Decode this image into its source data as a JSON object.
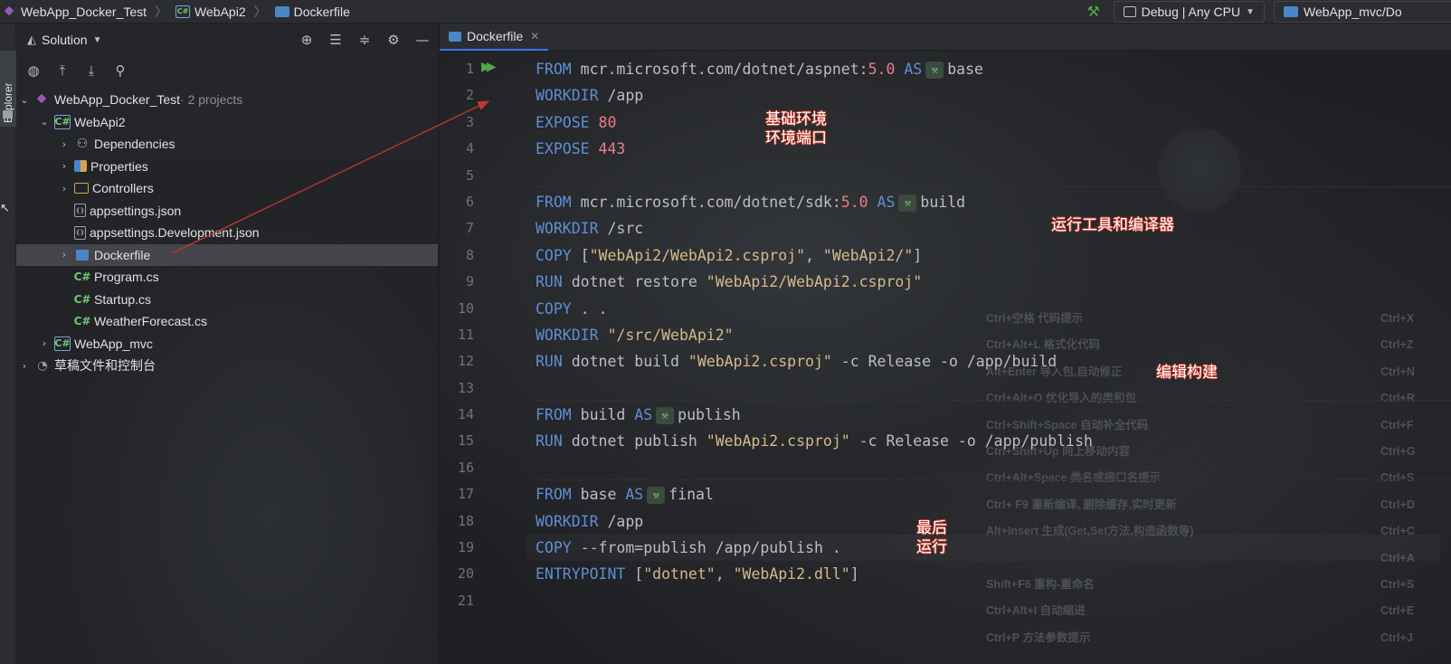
{
  "breadcrumb": {
    "solution": "WebApp_Docker_Test",
    "project": "WebApi2",
    "file": "Dockerfile"
  },
  "run_config": {
    "build_config": "Debug | Any CPU",
    "target": "WebApp_mvc/Do"
  },
  "sidebar_strip": {
    "label": "Explorer"
  },
  "explorer": {
    "title": "Solution",
    "tree": [
      {
        "label": "WebApp_Docker_Test",
        "suffix": " · 2 projects"
      },
      {
        "label": "WebApi2"
      },
      {
        "label": "Dependencies"
      },
      {
        "label": "Properties"
      },
      {
        "label": "Controllers"
      },
      {
        "label": "appsettings.json"
      },
      {
        "label": "appsettings.Development.json"
      },
      {
        "label": "Dockerfile"
      },
      {
        "label": "Program.cs"
      },
      {
        "label": "Startup.cs"
      },
      {
        "label": "WeatherForecast.cs"
      },
      {
        "label": "WebApp_mvc"
      },
      {
        "label": "草稿文件和控制台"
      }
    ],
    "icon_text": {
      "cs": "C#",
      "json": "{}"
    }
  },
  "editor": {
    "tab_label": "Dockerfile",
    "line_numbers": [
      "1",
      "2",
      "3",
      "4",
      "5",
      "6",
      "7",
      "8",
      "9",
      "10",
      "11",
      "12",
      "13",
      "14",
      "15",
      "16",
      "17",
      "18",
      "19",
      "20",
      "21"
    ],
    "lines": [
      [
        "FROM",
        " mcr.microsoft.com/dotnet/aspnet:",
        "5.0",
        " ",
        "AS",
        "base"
      ],
      [
        "WORKDIR",
        " /app"
      ],
      [
        "EXPOSE",
        " ",
        "80"
      ],
      [
        "EXPOSE",
        " ",
        "443"
      ],
      [],
      [
        "FROM",
        " mcr.microsoft.com/dotnet/sdk:",
        "5.0",
        " ",
        "AS",
        "build"
      ],
      [
        "WORKDIR",
        " /src"
      ],
      [
        "COPY",
        " [",
        "\"WebApi2/WebApi2.csproj\"",
        ", ",
        "\"WebApi2/\"",
        "]"
      ],
      [
        "RUN",
        " dotnet restore ",
        "\"WebApi2/WebApi2.csproj\""
      ],
      [
        "COPY",
        " . ."
      ],
      [
        "WORKDIR",
        " ",
        "\"/src/WebApi2\""
      ],
      [
        "RUN",
        " dotnet build ",
        "\"WebApi2.csproj\"",
        " -c Release -o /app/build"
      ],
      [],
      [
        "FROM",
        " build ",
        "AS",
        "publish"
      ],
      [
        "RUN",
        " dotnet publish ",
        "\"WebApi2.csproj\"",
        " -c Release -o /app/publish"
      ],
      [],
      [
        "FROM",
        " base ",
        "AS",
        "final"
      ],
      [
        "WORKDIR",
        " /app"
      ],
      [
        "COPY",
        " --from=publish /app/publish ."
      ],
      [
        "ENTRYPOINT",
        " [",
        "\"dotnet\"",
        ", ",
        "\"WebApi2.dll\"",
        "]"
      ],
      []
    ]
  },
  "annotations": {
    "base_env": "基础环境",
    "env_port": "环境端口",
    "runtime_compiler": "运行工具和编译器",
    "compile_build": "编辑构建",
    "final_a": "最后",
    "final_b": "运行"
  },
  "shortcut_hints": [
    {
      "text": "Ctrl+空格  代码提示",
      "right": "Ctrl+X"
    },
    {
      "text": "Ctrl+Alt+L  格式化代码",
      "right": "Ctrl+Z"
    },
    {
      "text": "Alt+Enter  导入包,自动修正",
      "right": "Ctrl+N"
    },
    {
      "text": "Ctrl+Alt+O  优化导入的类和包",
      "right": "Ctrl+R"
    },
    {
      "text": "Ctrl+Shift+Space 自动补全代码",
      "right": "Ctrl+F"
    },
    {
      "text": "Ctrl+Shift+Up 向上移动内容",
      "right": "Ctrl+G"
    },
    {
      "text": "Ctrl+Alt+Space  类名或接口名提示",
      "right": "Ctrl+S"
    },
    {
      "text": " Ctrl+ F9 重新编译, 删除缓存,实时更新",
      "right": "Ctrl+D"
    },
    {
      "text": "Alt+Insert  生成(Get,Set方法,构造函数等)",
      "right": "Ctrl+C"
    },
    {
      "text": "",
      "right": "Ctrl+A"
    },
    {
      "text": "Shift+F6  重构-重命名",
      "right": "Ctrl+S"
    },
    {
      "text": "Ctrl+Alt+I  自动缩进",
      "right": "Ctrl+E"
    },
    {
      "text": "Ctrl+P   方法参数提示",
      "right": "Ctrl+J"
    }
  ],
  "colors": {
    "keyword": "#5f8ed6",
    "number": "#e57f8d",
    "string": "#d7b98c",
    "accent": "#3574f0",
    "annotation_arrow": "#c0392b"
  }
}
